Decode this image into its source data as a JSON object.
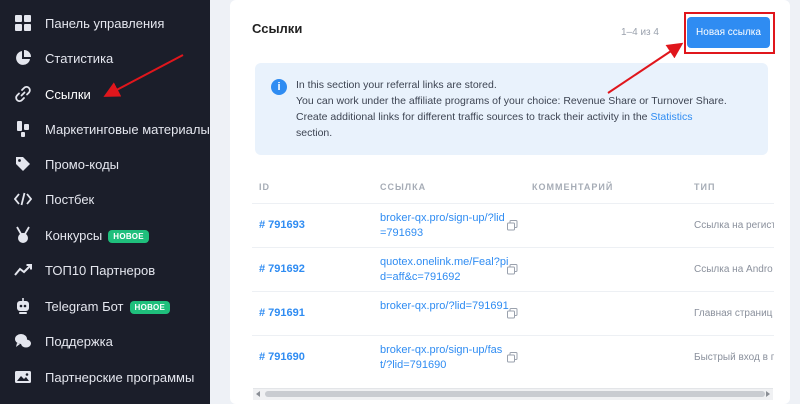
{
  "sidebar": {
    "items": [
      {
        "label": "Панель управления",
        "icon": "dashboard-icon"
      },
      {
        "label": "Статистика",
        "icon": "pie-chart-icon"
      },
      {
        "label": "Ссылки",
        "icon": "link-icon",
        "active": true
      },
      {
        "label": "Маркетинговые материалы",
        "icon": "marketing-icon"
      },
      {
        "label": "Промо-коды",
        "icon": "tag-icon"
      },
      {
        "label": "Постбек",
        "icon": "code-icon"
      },
      {
        "label": "Конкурсы",
        "icon": "medal-icon",
        "badge": "НОВОЕ"
      },
      {
        "label": "ТОП10 Партнеров",
        "icon": "trend-icon"
      },
      {
        "label": "Telegram Бот",
        "icon": "bot-icon",
        "badge": "НОВОЕ"
      },
      {
        "label": "Поддержка",
        "icon": "chat-icon"
      },
      {
        "label": "Партнерские программы",
        "icon": "image-icon"
      }
    ]
  },
  "main": {
    "title": "Ссылки",
    "counter": "1–4 из 4",
    "new_link_button": "Новая ссылка",
    "info": {
      "line1": "In this section your referral links are stored.",
      "line2": "You can work under the affiliate programs of your choice: Revenue Share or Turnover Share.",
      "line3_pre": "Create additional links for different traffic sources to track their activity in the ",
      "line3_link": "Statistics",
      "line3_post": "section."
    },
    "table": {
      "headers": [
        "ID",
        "ССЫЛКА",
        "КОММЕНТАРИЙ",
        "ТИП"
      ],
      "rows": [
        {
          "id": "# 791693",
          "link": "broker-qx.pro/sign-up/?lid=791693",
          "comment": "",
          "type": "Ссылка на регист"
        },
        {
          "id": "# 791692",
          "link": "quotex.onelink.me/Feal?pid=aff&c=791692",
          "comment": "",
          "type": "Ссылка на Andro"
        },
        {
          "id": "# 791691",
          "link": "broker-qx.pro/?lid=791691",
          "comment": "",
          "type": "Главная страниц"
        },
        {
          "id": "# 791690",
          "link": "broker-qx.pro/sign-up/fast/?lid=791690",
          "comment": "",
          "type": "Быстрый вход в п"
        }
      ]
    }
  },
  "colors": {
    "sidebar_bg": "#1b1e2a",
    "accent": "#2f8cf2",
    "badge": "#1fbf7c",
    "annotation": "#e0161c"
  }
}
